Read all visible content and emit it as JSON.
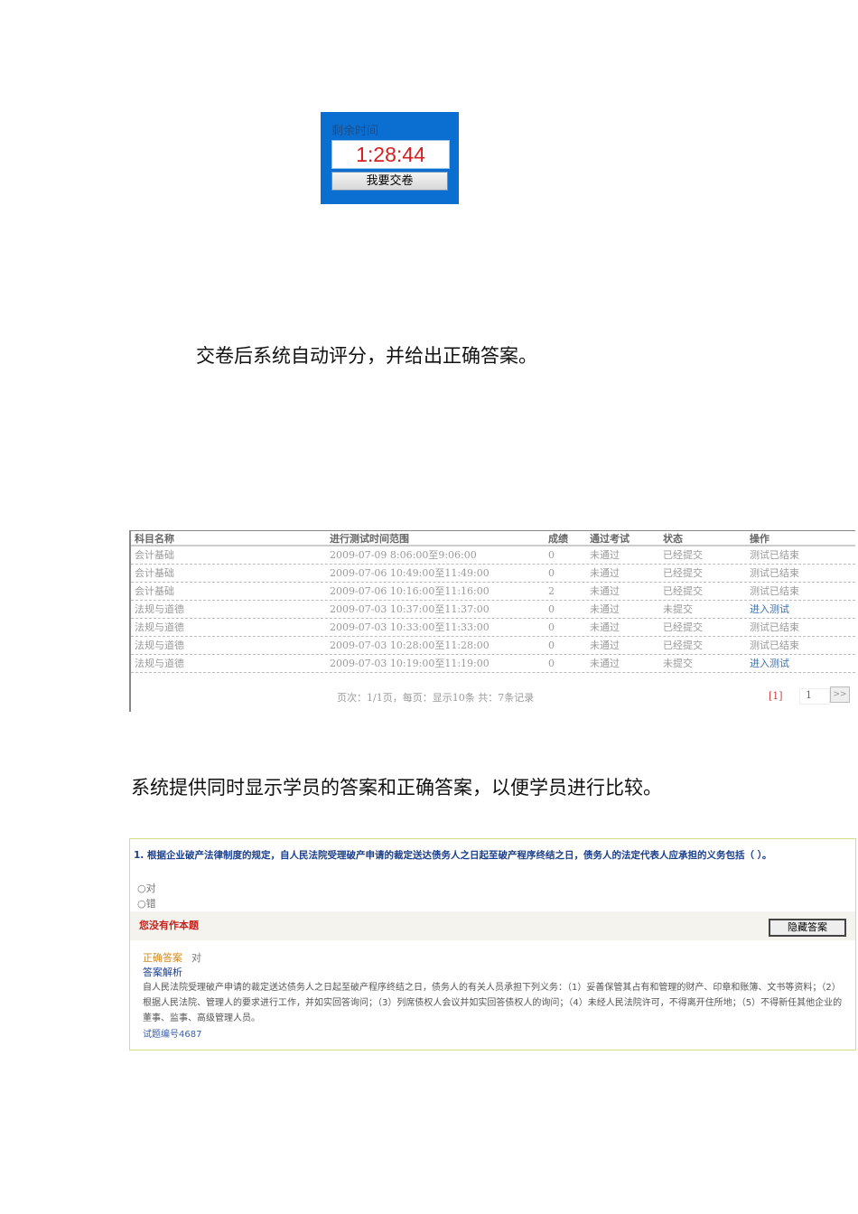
{
  "timer": {
    "label": "剩余时间",
    "time": "1:28:44",
    "submit": "我要交卷"
  },
  "para1": "交卷后系统自动评分，并给出正确答案。",
  "table": {
    "headers": [
      "科目名称",
      "进行测试时间范围",
      "成绩",
      "通过考试",
      "状态",
      "操作"
    ],
    "rows": [
      [
        "会计基础",
        "2009-07-09 8:06:00至9:06:00",
        "0",
        "未通过",
        "已经提交",
        "测试已结束"
      ],
      [
        "会计基础",
        "2009-07-06 10:49:00至11:49:00",
        "0",
        "未通过",
        "已经提交",
        "测试已结束"
      ],
      [
        "会计基础",
        "2009-07-06 10:16:00至11:16:00",
        "2",
        "未通过",
        "已经提交",
        "测试已结束"
      ],
      [
        "法规与道德",
        "2009-07-03 10:37:00至11:37:00",
        "0",
        "未通过",
        "未提交",
        "进入测试"
      ],
      [
        "法规与道德",
        "2009-07-03 10:33:00至11:33:00",
        "0",
        "未通过",
        "已经提交",
        "测试已结束"
      ],
      [
        "法规与道德",
        "2009-07-03 10:28:00至11:28:00",
        "0",
        "未通过",
        "已经提交",
        "测试已结束"
      ],
      [
        "法规与道德",
        "2009-07-03 10:19:00至11:19:00",
        "0",
        "未通过",
        "未提交",
        "进入测试"
      ]
    ],
    "footer": "页次：1/1页，每页：显示10条 共：7条记录",
    "page_link": "[1]",
    "page_input": "1",
    "next": ">>"
  },
  "para2": "系统提供同时显示学员的答案和正确答案，以便学员进行比较。",
  "question": {
    "title": "1. 根据企业破产法律制度的规定，自人民法院受理破产申请的裁定送达债务人之日起至破产程序终结之日，债务人的法定代表人应承担的义务包括（ ）。",
    "options": [
      "对",
      "错"
    ],
    "warning": "您没有作本题",
    "hide_button": "隐藏答案",
    "answer_label": "正确答案",
    "answer": "对",
    "analysis_label": "答案解析",
    "analysis": "自人民法院受理破产申请的裁定送达债务人之日起至破产程序终结之日，债务人的有关人员承担下列义务：（1）妥善保管其占有和管理的财产、印章和账簿、文书等资料；（2）根据人民法院、管理人的要求进行工作，并如实回答询问；（3）列席债权人会议并如实回答债权人的询问；（4）未经人民法院许可，不得离开住所地；（5）不得新任其他企业的董事、监事、高级管理人员。",
    "id": "试题编号4687"
  }
}
